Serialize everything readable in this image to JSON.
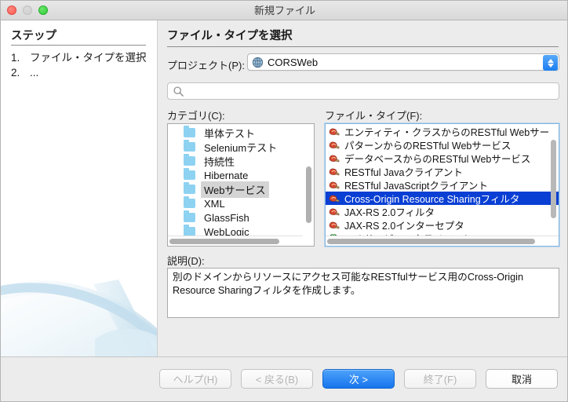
{
  "window": {
    "title": "新規ファイル",
    "traffic_lights": [
      "close-red",
      "minimize-gray",
      "zoom-green"
    ]
  },
  "sidebar": {
    "heading": "ステップ",
    "steps": [
      {
        "num": "1.",
        "label": "ファイル・タイプを選択"
      },
      {
        "num": "2.",
        "label": "..."
      }
    ]
  },
  "main": {
    "panel_title": "ファイル・タイプを選択",
    "project": {
      "label": "プロジェクト(P):",
      "value": "CORSWeb",
      "icon": "globe-icon",
      "stepper_icon": "up-down-arrows-icon"
    },
    "search": {
      "value": "",
      "placeholder": "",
      "icon": "search-icon"
    },
    "category": {
      "label": "カテゴリ(C):",
      "items": [
        {
          "label": "単体テスト",
          "selected": false
        },
        {
          "label": "Seleniumテスト",
          "selected": false
        },
        {
          "label": "持続性",
          "selected": false
        },
        {
          "label": "Hibernate",
          "selected": false
        },
        {
          "label": "Webサービス",
          "selected": true
        },
        {
          "label": "XML",
          "selected": false
        },
        {
          "label": "GlassFish",
          "selected": false
        },
        {
          "label": "WebLogic",
          "selected": false
        }
      ]
    },
    "filetype": {
      "label": "ファイル・タイプ(F):",
      "items": [
        {
          "label": "エンティティ・クラスからのRESTful Webサー",
          "icon": "restful-service-icon",
          "selected": false
        },
        {
          "label": "パターンからのRESTful Webサービス",
          "icon": "restful-service-icon",
          "selected": false
        },
        {
          "label": "データベースからのRESTful Webサービス",
          "icon": "restful-service-icon",
          "selected": false
        },
        {
          "label": "RESTful Javaクライアント",
          "icon": "restful-service-icon",
          "selected": false
        },
        {
          "label": "RESTful JavaScriptクライアント",
          "icon": "restful-service-icon",
          "selected": false
        },
        {
          "label": "Cross-Origin Resource Sharingフィルタ",
          "icon": "restful-service-icon",
          "selected": true
        },
        {
          "label": "JAX-RS 2.0フィルタ",
          "icon": "restful-service-icon",
          "selected": false
        },
        {
          "label": "JAX-RS 2.0インターセプタ",
          "icon": "restful-service-icon",
          "selected": false
        },
        {
          "label": "Webサービス・クライアント",
          "icon": "web-service-client-icon",
          "selected": false
        }
      ]
    },
    "description": {
      "label": "説明(D):",
      "text": "別のドメインからリソースにアクセス可能なRESTfulサービス用のCross-Origin Resource Sharingフィルタを作成します。"
    }
  },
  "footer": {
    "buttons": [
      {
        "label": "ヘルプ(H)",
        "state": "disabled"
      },
      {
        "label": "< 戻る(B)",
        "state": "disabled"
      },
      {
        "label": "次 >",
        "state": "primary"
      },
      {
        "label": "終了(F)",
        "state": "disabled"
      },
      {
        "label": "取消",
        "state": "enabled"
      }
    ]
  },
  "colors": {
    "selection_blue": "#0a3fd4",
    "primary_button": "#1775ed",
    "folder_blue": "#8ed2f2",
    "swoosh_blue": "#bfdcea"
  }
}
